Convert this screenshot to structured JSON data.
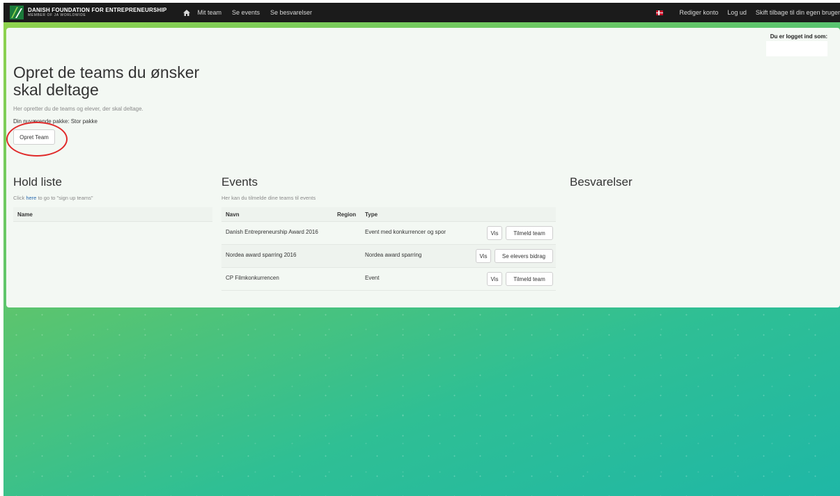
{
  "brand": {
    "title": "DANISH FOUNDATION FOR ENTREPRENEURSHIP",
    "subtitle": "MEMBER OF JA WORLDWIDE",
    "logo_colors": [
      "#1b7a3b",
      "#8fd24d"
    ]
  },
  "nav": {
    "left": [
      "Mit team",
      "Se events",
      "Se besvarelser"
    ],
    "right": [
      "Rediger konto",
      "Log ud",
      "Skift tilbage til din egen bruger"
    ]
  },
  "login": {
    "label": "Du er logget ind som:"
  },
  "page": {
    "title": "Opret de teams du ønsker skal deltage",
    "subtitle": "Her opretter du de teams og elever, der skal deltage.",
    "package": "Din nuværende pakke: Stor pakke",
    "create_button": "Opret Team"
  },
  "hold": {
    "title": "Hold liste",
    "hint_prefix": "Click ",
    "hint_link": "here",
    "hint_suffix": " to go to \"sign up teams\"",
    "columns": [
      "Name"
    ]
  },
  "events": {
    "title": "Events",
    "hint": "Her kan du tilmelde dine teams til events",
    "columns": {
      "name": "Navn",
      "region": "Region",
      "type": "Type"
    },
    "rows": [
      {
        "name": "Danish Entrepreneurship Award 2016",
        "region": "",
        "type": "Event med konkurrencer og spor",
        "buttons": [
          "Vis",
          "Tilmeld team"
        ]
      },
      {
        "name": "Nordea award sparring 2016",
        "region": "",
        "type": "Nordea award sparring",
        "buttons": [
          "Vis",
          "Se elevers bidrag"
        ]
      },
      {
        "name": "CP Filmkonkurrencen",
        "region": "",
        "type": "Event",
        "buttons": [
          "Vis",
          "Tilmeld team"
        ]
      }
    ]
  },
  "besvarelser": {
    "title": "Besvarelser"
  },
  "colors": {
    "navbar": "#1b1b1b",
    "annotation": "#e02a2a",
    "link": "#2b6cb0"
  }
}
